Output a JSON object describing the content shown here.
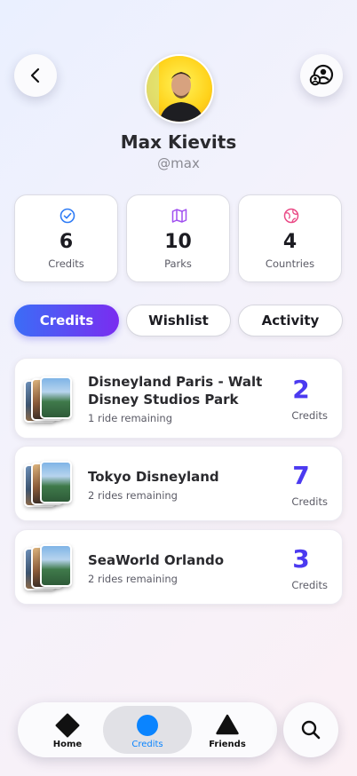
{
  "profile": {
    "name": "Max Kievits",
    "handle": "@max"
  },
  "stats": [
    {
      "value": "6",
      "label": "Credits",
      "icon": "check-circle-icon",
      "color": "#2f7cf6"
    },
    {
      "value": "10",
      "label": "Parks",
      "icon": "map-icon",
      "color": "#a04ff0"
    },
    {
      "value": "4",
      "label": "Countries",
      "icon": "globe-icon",
      "color": "#ea4a86"
    }
  ],
  "tabs": [
    {
      "label": "Credits",
      "active": true
    },
    {
      "label": "Wishlist",
      "active": false
    },
    {
      "label": "Activity",
      "active": false
    }
  ],
  "parks": [
    {
      "title": "Disneyland Paris - Walt Disney Studios Park",
      "subtitle": "1 ride remaining",
      "count": "2",
      "unit": "Credits"
    },
    {
      "title": "Tokyo Disneyland",
      "subtitle": "2 rides remaining",
      "count": "7",
      "unit": "Credits"
    },
    {
      "title": "SeaWorld Orlando",
      "subtitle": "2 rides remaining",
      "count": "3",
      "unit": "Credits"
    }
  ],
  "nav": [
    {
      "label": "Home",
      "icon": "diamond-icon",
      "active": false
    },
    {
      "label": "Credits",
      "icon": "circle-icon",
      "active": true
    },
    {
      "label": "Friends",
      "icon": "triangle-icon",
      "active": false
    }
  ],
  "colors": {
    "accent": "#4b3af0",
    "nav_active": "#0a84ff"
  }
}
